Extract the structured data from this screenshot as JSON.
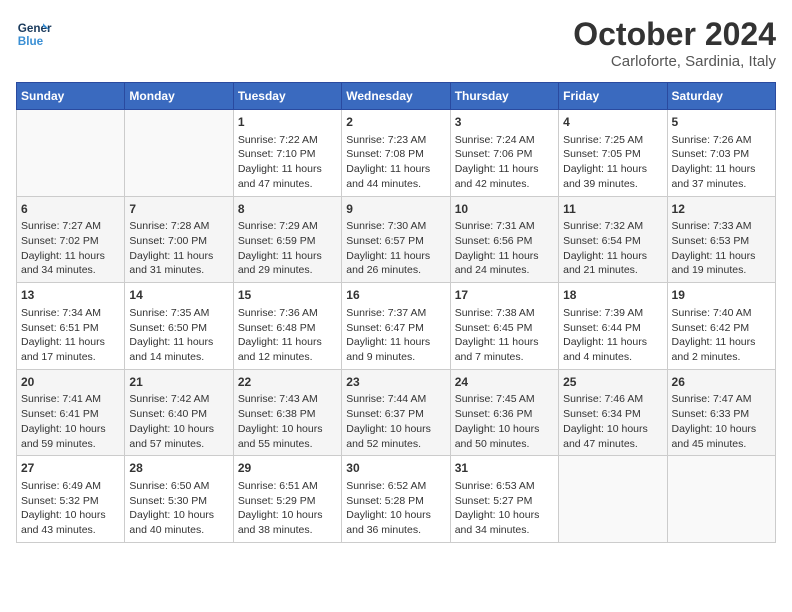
{
  "header": {
    "logo_line1": "General",
    "logo_line2": "Blue",
    "month": "October 2024",
    "location": "Carloforte, Sardinia, Italy"
  },
  "days_of_week": [
    "Sunday",
    "Monday",
    "Tuesday",
    "Wednesday",
    "Thursday",
    "Friday",
    "Saturday"
  ],
  "weeks": [
    [
      {
        "day": "",
        "info": ""
      },
      {
        "day": "",
        "info": ""
      },
      {
        "day": "1",
        "info": "Sunrise: 7:22 AM\nSunset: 7:10 PM\nDaylight: 11 hours and 47 minutes."
      },
      {
        "day": "2",
        "info": "Sunrise: 7:23 AM\nSunset: 7:08 PM\nDaylight: 11 hours and 44 minutes."
      },
      {
        "day": "3",
        "info": "Sunrise: 7:24 AM\nSunset: 7:06 PM\nDaylight: 11 hours and 42 minutes."
      },
      {
        "day": "4",
        "info": "Sunrise: 7:25 AM\nSunset: 7:05 PM\nDaylight: 11 hours and 39 minutes."
      },
      {
        "day": "5",
        "info": "Sunrise: 7:26 AM\nSunset: 7:03 PM\nDaylight: 11 hours and 37 minutes."
      }
    ],
    [
      {
        "day": "6",
        "info": "Sunrise: 7:27 AM\nSunset: 7:02 PM\nDaylight: 11 hours and 34 minutes."
      },
      {
        "day": "7",
        "info": "Sunrise: 7:28 AM\nSunset: 7:00 PM\nDaylight: 11 hours and 31 minutes."
      },
      {
        "day": "8",
        "info": "Sunrise: 7:29 AM\nSunset: 6:59 PM\nDaylight: 11 hours and 29 minutes."
      },
      {
        "day": "9",
        "info": "Sunrise: 7:30 AM\nSunset: 6:57 PM\nDaylight: 11 hours and 26 minutes."
      },
      {
        "day": "10",
        "info": "Sunrise: 7:31 AM\nSunset: 6:56 PM\nDaylight: 11 hours and 24 minutes."
      },
      {
        "day": "11",
        "info": "Sunrise: 7:32 AM\nSunset: 6:54 PM\nDaylight: 11 hours and 21 minutes."
      },
      {
        "day": "12",
        "info": "Sunrise: 7:33 AM\nSunset: 6:53 PM\nDaylight: 11 hours and 19 minutes."
      }
    ],
    [
      {
        "day": "13",
        "info": "Sunrise: 7:34 AM\nSunset: 6:51 PM\nDaylight: 11 hours and 17 minutes."
      },
      {
        "day": "14",
        "info": "Sunrise: 7:35 AM\nSunset: 6:50 PM\nDaylight: 11 hours and 14 minutes."
      },
      {
        "day": "15",
        "info": "Sunrise: 7:36 AM\nSunset: 6:48 PM\nDaylight: 11 hours and 12 minutes."
      },
      {
        "day": "16",
        "info": "Sunrise: 7:37 AM\nSunset: 6:47 PM\nDaylight: 11 hours and 9 minutes."
      },
      {
        "day": "17",
        "info": "Sunrise: 7:38 AM\nSunset: 6:45 PM\nDaylight: 11 hours and 7 minutes."
      },
      {
        "day": "18",
        "info": "Sunrise: 7:39 AM\nSunset: 6:44 PM\nDaylight: 11 hours and 4 minutes."
      },
      {
        "day": "19",
        "info": "Sunrise: 7:40 AM\nSunset: 6:42 PM\nDaylight: 11 hours and 2 minutes."
      }
    ],
    [
      {
        "day": "20",
        "info": "Sunrise: 7:41 AM\nSunset: 6:41 PM\nDaylight: 10 hours and 59 minutes."
      },
      {
        "day": "21",
        "info": "Sunrise: 7:42 AM\nSunset: 6:40 PM\nDaylight: 10 hours and 57 minutes."
      },
      {
        "day": "22",
        "info": "Sunrise: 7:43 AM\nSunset: 6:38 PM\nDaylight: 10 hours and 55 minutes."
      },
      {
        "day": "23",
        "info": "Sunrise: 7:44 AM\nSunset: 6:37 PM\nDaylight: 10 hours and 52 minutes."
      },
      {
        "day": "24",
        "info": "Sunrise: 7:45 AM\nSunset: 6:36 PM\nDaylight: 10 hours and 50 minutes."
      },
      {
        "day": "25",
        "info": "Sunrise: 7:46 AM\nSunset: 6:34 PM\nDaylight: 10 hours and 47 minutes."
      },
      {
        "day": "26",
        "info": "Sunrise: 7:47 AM\nSunset: 6:33 PM\nDaylight: 10 hours and 45 minutes."
      }
    ],
    [
      {
        "day": "27",
        "info": "Sunrise: 6:49 AM\nSunset: 5:32 PM\nDaylight: 10 hours and 43 minutes."
      },
      {
        "day": "28",
        "info": "Sunrise: 6:50 AM\nSunset: 5:30 PM\nDaylight: 10 hours and 40 minutes."
      },
      {
        "day": "29",
        "info": "Sunrise: 6:51 AM\nSunset: 5:29 PM\nDaylight: 10 hours and 38 minutes."
      },
      {
        "day": "30",
        "info": "Sunrise: 6:52 AM\nSunset: 5:28 PM\nDaylight: 10 hours and 36 minutes."
      },
      {
        "day": "31",
        "info": "Sunrise: 6:53 AM\nSunset: 5:27 PM\nDaylight: 10 hours and 34 minutes."
      },
      {
        "day": "",
        "info": ""
      },
      {
        "day": "",
        "info": ""
      }
    ]
  ]
}
